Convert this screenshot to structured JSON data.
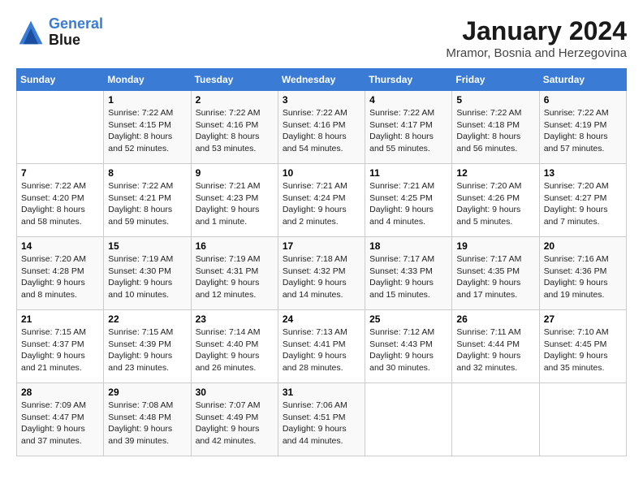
{
  "header": {
    "logo_line1": "General",
    "logo_line2": "Blue",
    "month": "January 2024",
    "location": "Mramor, Bosnia and Herzegovina"
  },
  "weekdays": [
    "Sunday",
    "Monday",
    "Tuesday",
    "Wednesday",
    "Thursday",
    "Friday",
    "Saturday"
  ],
  "weeks": [
    [
      {
        "day": "",
        "info": ""
      },
      {
        "day": "1",
        "info": "Sunrise: 7:22 AM\nSunset: 4:15 PM\nDaylight: 8 hours\nand 52 minutes."
      },
      {
        "day": "2",
        "info": "Sunrise: 7:22 AM\nSunset: 4:16 PM\nDaylight: 8 hours\nand 53 minutes."
      },
      {
        "day": "3",
        "info": "Sunrise: 7:22 AM\nSunset: 4:16 PM\nDaylight: 8 hours\nand 54 minutes."
      },
      {
        "day": "4",
        "info": "Sunrise: 7:22 AM\nSunset: 4:17 PM\nDaylight: 8 hours\nand 55 minutes."
      },
      {
        "day": "5",
        "info": "Sunrise: 7:22 AM\nSunset: 4:18 PM\nDaylight: 8 hours\nand 56 minutes."
      },
      {
        "day": "6",
        "info": "Sunrise: 7:22 AM\nSunset: 4:19 PM\nDaylight: 8 hours\nand 57 minutes."
      }
    ],
    [
      {
        "day": "7",
        "info": "Sunrise: 7:22 AM\nSunset: 4:20 PM\nDaylight: 8 hours\nand 58 minutes."
      },
      {
        "day": "8",
        "info": "Sunrise: 7:22 AM\nSunset: 4:21 PM\nDaylight: 8 hours\nand 59 minutes."
      },
      {
        "day": "9",
        "info": "Sunrise: 7:21 AM\nSunset: 4:23 PM\nDaylight: 9 hours\nand 1 minute."
      },
      {
        "day": "10",
        "info": "Sunrise: 7:21 AM\nSunset: 4:24 PM\nDaylight: 9 hours\nand 2 minutes."
      },
      {
        "day": "11",
        "info": "Sunrise: 7:21 AM\nSunset: 4:25 PM\nDaylight: 9 hours\nand 4 minutes."
      },
      {
        "day": "12",
        "info": "Sunrise: 7:20 AM\nSunset: 4:26 PM\nDaylight: 9 hours\nand 5 minutes."
      },
      {
        "day": "13",
        "info": "Sunrise: 7:20 AM\nSunset: 4:27 PM\nDaylight: 9 hours\nand 7 minutes."
      }
    ],
    [
      {
        "day": "14",
        "info": "Sunrise: 7:20 AM\nSunset: 4:28 PM\nDaylight: 9 hours\nand 8 minutes."
      },
      {
        "day": "15",
        "info": "Sunrise: 7:19 AM\nSunset: 4:30 PM\nDaylight: 9 hours\nand 10 minutes."
      },
      {
        "day": "16",
        "info": "Sunrise: 7:19 AM\nSunset: 4:31 PM\nDaylight: 9 hours\nand 12 minutes."
      },
      {
        "day": "17",
        "info": "Sunrise: 7:18 AM\nSunset: 4:32 PM\nDaylight: 9 hours\nand 14 minutes."
      },
      {
        "day": "18",
        "info": "Sunrise: 7:17 AM\nSunset: 4:33 PM\nDaylight: 9 hours\nand 15 minutes."
      },
      {
        "day": "19",
        "info": "Sunrise: 7:17 AM\nSunset: 4:35 PM\nDaylight: 9 hours\nand 17 minutes."
      },
      {
        "day": "20",
        "info": "Sunrise: 7:16 AM\nSunset: 4:36 PM\nDaylight: 9 hours\nand 19 minutes."
      }
    ],
    [
      {
        "day": "21",
        "info": "Sunrise: 7:15 AM\nSunset: 4:37 PM\nDaylight: 9 hours\nand 21 minutes."
      },
      {
        "day": "22",
        "info": "Sunrise: 7:15 AM\nSunset: 4:39 PM\nDaylight: 9 hours\nand 23 minutes."
      },
      {
        "day": "23",
        "info": "Sunrise: 7:14 AM\nSunset: 4:40 PM\nDaylight: 9 hours\nand 26 minutes."
      },
      {
        "day": "24",
        "info": "Sunrise: 7:13 AM\nSunset: 4:41 PM\nDaylight: 9 hours\nand 28 minutes."
      },
      {
        "day": "25",
        "info": "Sunrise: 7:12 AM\nSunset: 4:43 PM\nDaylight: 9 hours\nand 30 minutes."
      },
      {
        "day": "26",
        "info": "Sunrise: 7:11 AM\nSunset: 4:44 PM\nDaylight: 9 hours\nand 32 minutes."
      },
      {
        "day": "27",
        "info": "Sunrise: 7:10 AM\nSunset: 4:45 PM\nDaylight: 9 hours\nand 35 minutes."
      }
    ],
    [
      {
        "day": "28",
        "info": "Sunrise: 7:09 AM\nSunset: 4:47 PM\nDaylight: 9 hours\nand 37 minutes."
      },
      {
        "day": "29",
        "info": "Sunrise: 7:08 AM\nSunset: 4:48 PM\nDaylight: 9 hours\nand 39 minutes."
      },
      {
        "day": "30",
        "info": "Sunrise: 7:07 AM\nSunset: 4:49 PM\nDaylight: 9 hours\nand 42 minutes."
      },
      {
        "day": "31",
        "info": "Sunrise: 7:06 AM\nSunset: 4:51 PM\nDaylight: 9 hours\nand 44 minutes."
      },
      {
        "day": "",
        "info": ""
      },
      {
        "day": "",
        "info": ""
      },
      {
        "day": "",
        "info": ""
      }
    ]
  ]
}
